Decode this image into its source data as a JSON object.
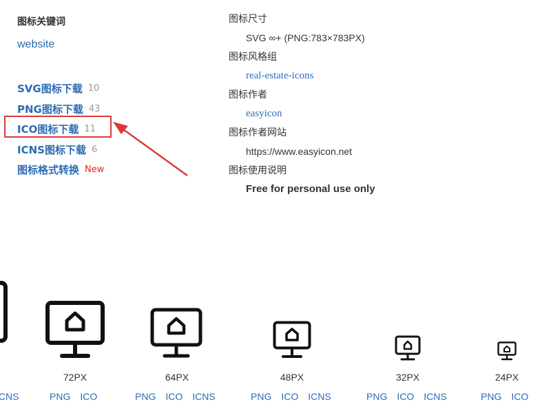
{
  "keywords": {
    "heading": "图标关键词",
    "link": "website"
  },
  "downloads": [
    {
      "label": "SVG图标下载",
      "count": "10"
    },
    {
      "label": "PNG图标下载",
      "count": "43"
    },
    {
      "label": "ICO图标下载",
      "count": "11",
      "highlighted": true
    },
    {
      "label": "ICNS图标下载",
      "count": "6"
    },
    {
      "label": "图标格式转换",
      "badge": "New"
    }
  ],
  "info": {
    "size_label": "图标尺寸",
    "size_value": "SVG ∞+ (PNG:783×783PX)",
    "style_label": "图标风格组",
    "style_value": "real-estate-icons",
    "author_label": "图标作者",
    "author_value": "easyicon",
    "site_label": "图标作者网站",
    "site_value": "https://www.easyicon.net",
    "usage_label": "图标使用说明",
    "usage_value": "Free for personal use only"
  },
  "icons": [
    {
      "size": "",
      "formats": [
        "ICNS"
      ]
    },
    {
      "size": "72PX",
      "formats": [
        "PNG",
        "ICO"
      ]
    },
    {
      "size": "64PX",
      "formats": [
        "PNG",
        "ICO",
        "ICNS"
      ]
    },
    {
      "size": "48PX",
      "formats": [
        "PNG",
        "ICO",
        "ICNS"
      ]
    },
    {
      "size": "32PX",
      "formats": [
        "PNG",
        "ICO",
        "ICNS"
      ]
    },
    {
      "size": "24PX",
      "formats": [
        "PNG",
        "ICO"
      ]
    }
  ],
  "colors": {
    "link": "#2c6cb3",
    "highlight": "#d83a3a",
    "new_badge": "#e2261d",
    "muted": "#999999"
  }
}
